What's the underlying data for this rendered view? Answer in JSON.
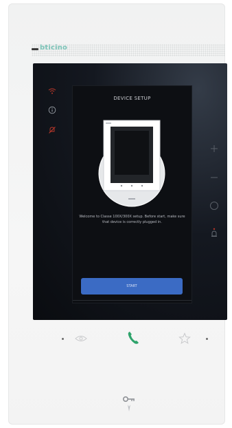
{
  "brand": {
    "name": "bticino"
  },
  "dialog": {
    "title": "DEVICE SETUP",
    "message": "Welcome to Classe 100X/300X setup. Before start, make sure that device is correctly plugged in.",
    "start_label": "START"
  },
  "colors": {
    "brand": "#7cc4b8",
    "accent_blue": "#3b6bc4",
    "call_green": "#2ea36b",
    "alert_red": "#c0392b"
  },
  "icons": {
    "left_column": [
      "wifi-icon",
      "info-icon",
      "no-disturb-icon"
    ],
    "right_column": [
      "plus-icon",
      "minus-icon",
      "circle-icon",
      "bell-icon"
    ],
    "bottom_row": [
      "eye-icon",
      "phone-icon",
      "star-icon"
    ],
    "bottom_key": "key-icon"
  }
}
